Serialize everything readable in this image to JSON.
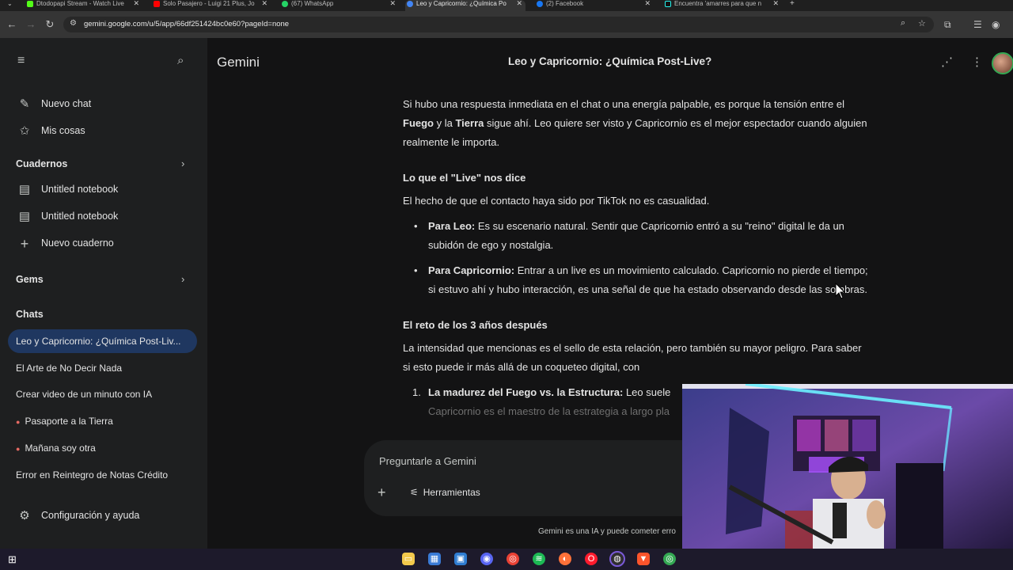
{
  "browser": {
    "tabs": [
      {
        "label": "Dtodopapi Stream - Watch Live",
        "color": "#53fc18"
      },
      {
        "label": "Solo Pasajero - Luigi 21 Plus, Jo",
        "color": "#ff0000"
      },
      {
        "label": "(67) WhatsApp",
        "color": "#25d366"
      },
      {
        "label": "Leo y Capricornio: ¿Química Po",
        "color": "#4285f4"
      },
      {
        "label": "(2) Facebook",
        "color": "#1877f2"
      },
      {
        "label": "Encuentra 'amarres para que n",
        "color": "#111111"
      }
    ],
    "url": "gemini.google.com/u/5/app/66df251424bc0e60?pageId=none"
  },
  "sidebar": {
    "new_chat": "Nuevo chat",
    "my_stuff": "Mis cosas",
    "notebooks_title": "Cuadernos",
    "notebooks": [
      "Untitled notebook",
      "Untitled notebook"
    ],
    "new_notebook": "Nuevo cuaderno",
    "gems_title": "Gems",
    "chats_title": "Chats",
    "chats": [
      "Leo y Capricornio: ¿Química Post-Liv...",
      "El Arte de No Decir Nada",
      "Crear video de un minuto con IA",
      "Pasaporte a la Tierra",
      "Mañana soy otra",
      "Error en Reintegro de Notas Crédito"
    ],
    "settings": "Configuración y ayuda"
  },
  "header": {
    "brand": "Gemini",
    "title": "Leo y Capricornio: ¿Química Post-Live?"
  },
  "content": {
    "p1_a": "Si hubo una respuesta inmediata en el chat o una energía palpable, es porque la tensión entre el ",
    "p1_fuego": "Fuego",
    "p1_b": " y la ",
    "p1_tierra": "Tierra",
    "p1_c": " sigue ahí. Leo quiere ser visto y Capricornio es el mejor espectador cuando alguien realmente le importa.",
    "h1": "Lo que el \"Live\" nos dice",
    "p2": "El hecho de que el contacto haya sido por TikTok no es casualidad.",
    "b1_title": "Para Leo:",
    "b1_text": " Es su escenario natural. Sentir que Capricornio entró a su \"reino\" digital le da un subidón de ego y nostalgia.",
    "b2_title": "Para Capricornio:",
    "b2_text": " Entrar a un live es un movimiento calculado. Capricornio no pierde el tiempo; si estuvo ahí y hubo interacción, es una señal de que ha estado observando desde las sombras.",
    "h2": "El reto de los 3 años después",
    "p3": "La intensidad que mencionas es el sello de esta relación, pero también su mayor peligro. Para saber si esto puede ir más allá de un coqueteo digital, con",
    "n1_num": "1.",
    "n1_title": "La madurez del Fuego vs. la Estructura:",
    "n1_text": " Leo suele",
    "n1_line2": "Capricornio es el maestro de la estrategia a largo pla"
  },
  "input": {
    "placeholder": "Preguntarle a Gemini",
    "tools": "Herramientas"
  },
  "disclaimer": "Gemini es una IA y puede cometer erro"
}
